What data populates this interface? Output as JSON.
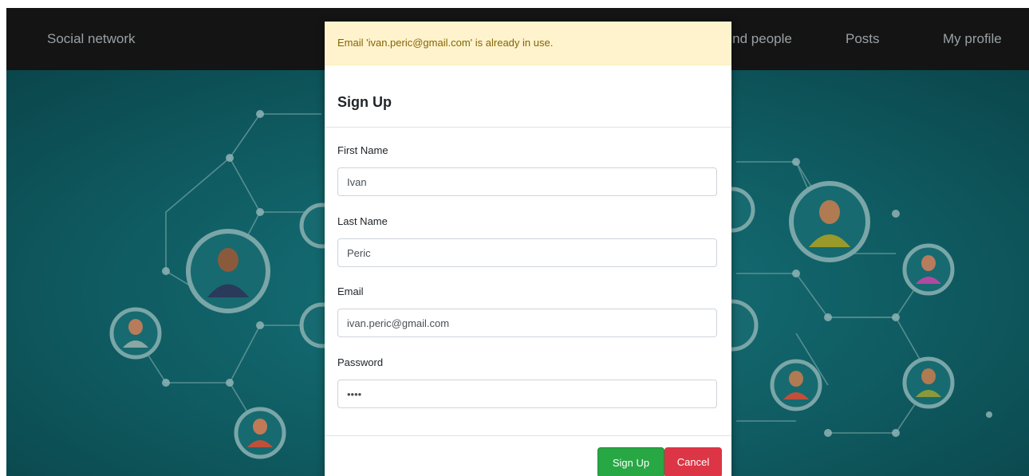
{
  "navbar": {
    "brand": "Social network",
    "links": [
      {
        "label": "Find people"
      },
      {
        "label": "Posts"
      },
      {
        "label": "My profile"
      }
    ]
  },
  "modal": {
    "alert": "Email 'ivan.peric@gmail.com' is already in use.",
    "title": "Sign Up",
    "fields": {
      "first_name": {
        "label": "First Name",
        "value": "Ivan"
      },
      "last_name": {
        "label": "Last Name",
        "value": "Peric"
      },
      "email": {
        "label": "Email",
        "value": "ivan.peric@gmail.com"
      },
      "password": {
        "label": "Password",
        "value": "1234"
      }
    },
    "buttons": {
      "submit": "Sign Up",
      "cancel": "Cancel"
    }
  },
  "colors": {
    "navbar_bg": "#141414",
    "hero_bg": "#0f5a60",
    "alert_bg": "#fff3cd",
    "alert_text": "#856404",
    "success": "#28a745",
    "danger": "#dc3545"
  }
}
